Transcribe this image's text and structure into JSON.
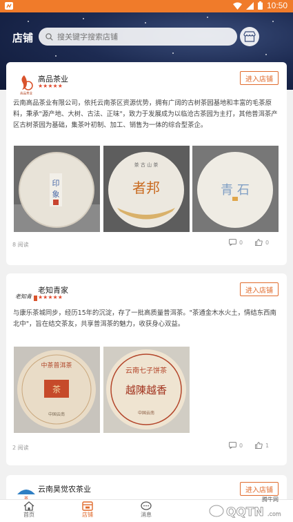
{
  "status_bar": {
    "time": "10:50"
  },
  "header": {
    "title": "店铺",
    "search_placeholder": "搜关键字搜索店铺"
  },
  "shops": [
    {
      "name": "高品茶业",
      "rating_stars": 5,
      "enter_label": "进入店铺",
      "description": "云南高品茶业有限公司，依托云南茶区资源优势，拥有广阔的古树茶园基地和丰富的毛茶原料，秉承\"源产地、大树、古法、正味\"，致力于发展成为以临沧古茶园为主打，其他普洱茶产区古树茶园为基础，集茶叶初制、加工、销售为一体的综合型茶企。",
      "photos": [
        "tea-cake-1",
        "tea-cake-2",
        "tea-cake-3"
      ],
      "reads": "8 阅读",
      "comments": "0",
      "likes": "0",
      "logo_text": "高品茶业"
    },
    {
      "name": "老知青家",
      "rating_stars": 5,
      "enter_label": "进入店铺",
      "description": "与康乐茶城同步，经历15年的沉淀，存了一批高质量普洱茶。\"茶通金木水火土，情结东西南北中\"，旨在结交茶友，共享普洱茶的魅力，收获身心双益。",
      "photos": [
        "tea-cake-4",
        "tea-cake-5"
      ],
      "reads": "2 阅读",
      "comments": "0",
      "likes": "1",
      "logo_text": "老知青"
    },
    {
      "name": "云南昊觉农茶业",
      "enter_label": "进入店铺"
    }
  ],
  "nav": [
    {
      "label": "首页",
      "icon": "home-icon"
    },
    {
      "label": "店铺",
      "icon": "store-icon",
      "active": true
    },
    {
      "label": "消息",
      "icon": "message-icon"
    }
  ],
  "watermark": {
    "text": "QQTN.com",
    "sub": "腾牛网"
  },
  "colors": {
    "accent": "#e06a2b",
    "status_bar": "#f07b2a",
    "star": "#e04b2f"
  }
}
